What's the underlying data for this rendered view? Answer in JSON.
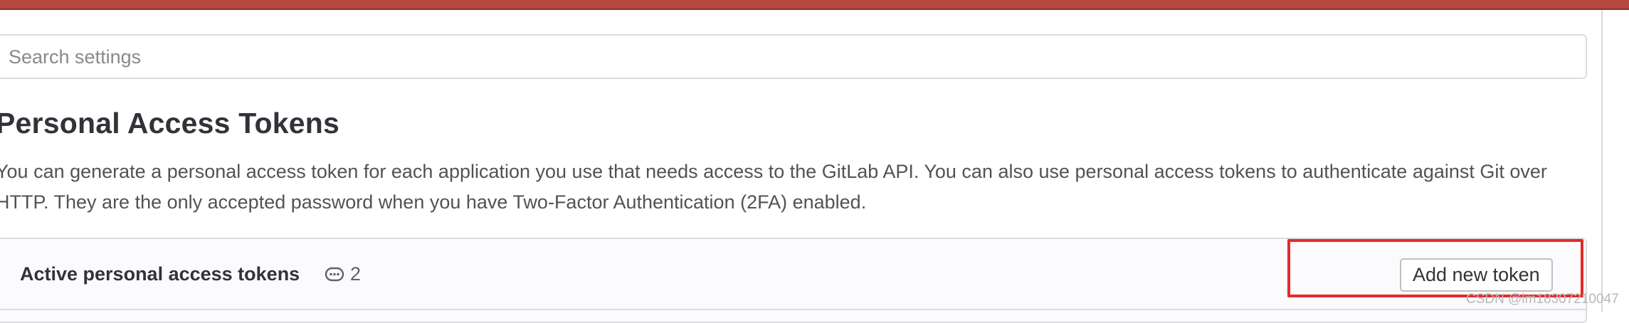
{
  "search": {
    "placeholder": "Search settings",
    "value": ""
  },
  "page": {
    "title": "Personal Access Tokens",
    "description": "You can generate a personal access token for each application you use that needs access to the GitLab API. You can also use personal access tokens to authenticate against Git over HTTP. They are the only accepted password when you have Two-Factor Authentication (2FA) enabled."
  },
  "tokens_card": {
    "title": "Active personal access tokens",
    "count_icon": "comment-icon",
    "count": "2",
    "add_button_label": "Add new token"
  },
  "watermark": "CSDN @lm18307210047",
  "colors": {
    "top_bar": "#b5493f",
    "highlight": "#e52a2a"
  }
}
